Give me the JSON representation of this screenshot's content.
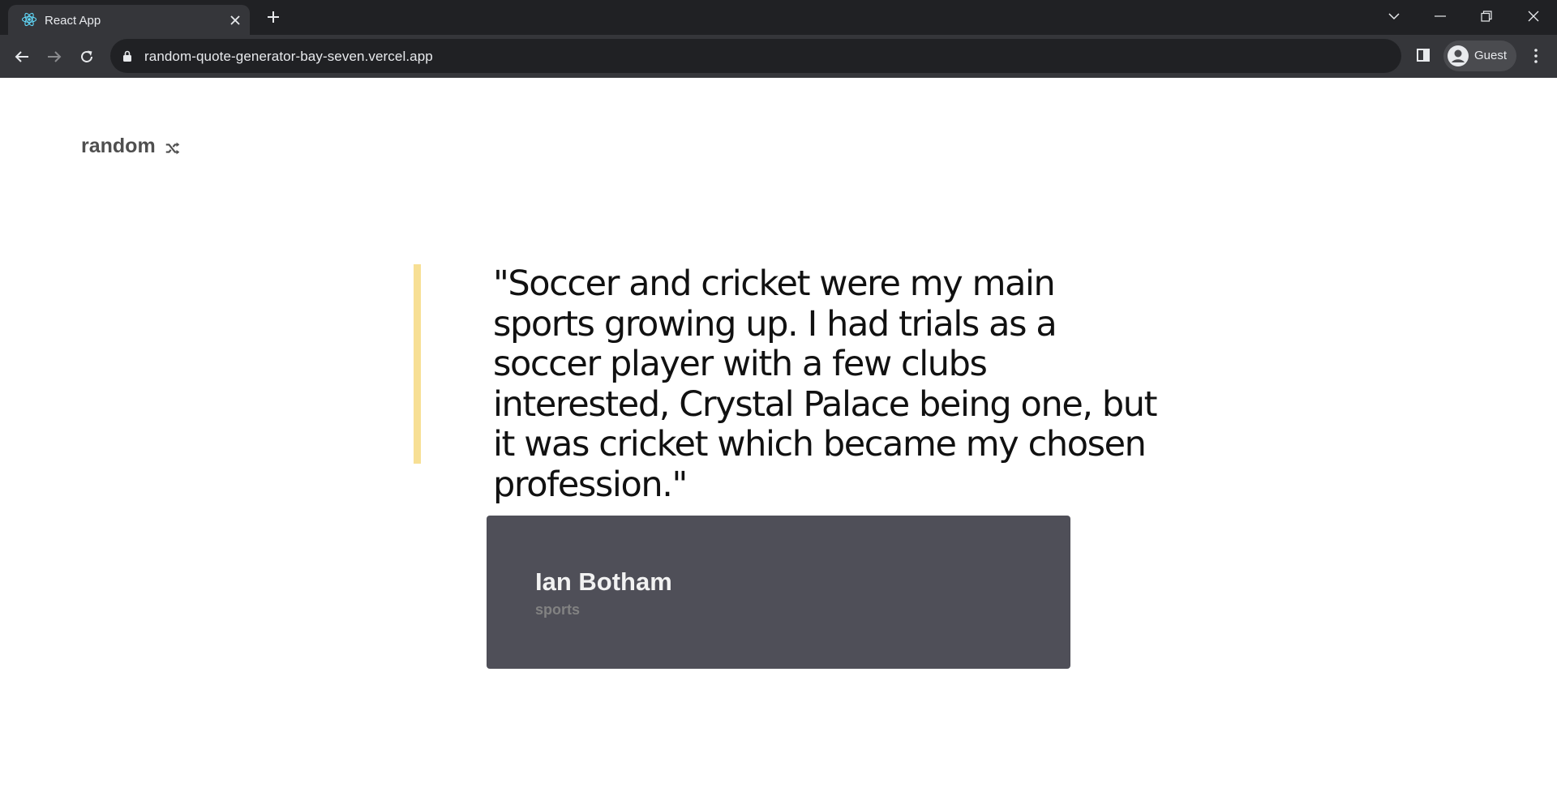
{
  "browser": {
    "tab": {
      "title": "React App",
      "favicon": "react-logo-icon"
    },
    "url": "random-quote-generator-bay-seven.vercel.app",
    "profile_label": "Guest"
  },
  "page": {
    "random_button_label": "random",
    "quote": "\"Soccer and cricket were my main sports growing up. I had trials as a soccer player with a few clubs interested, Crystal Palace being one, but it was cricket which became my chosen profession.\"",
    "author": "Ian Botham",
    "genre": "sports"
  },
  "colors": {
    "quote_bar": "#f7df94",
    "author_card": "#4f4f58",
    "author_genre": "#828282"
  }
}
